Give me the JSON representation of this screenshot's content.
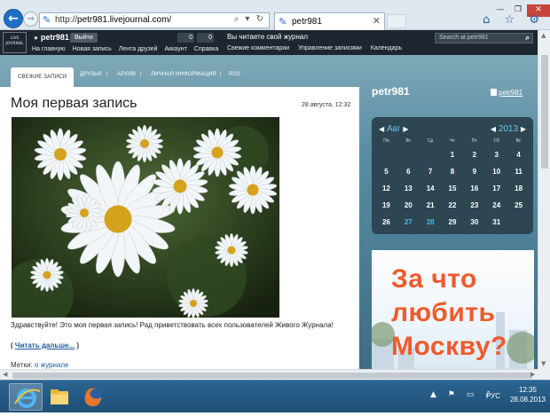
{
  "browser": {
    "url_prefix": "http://",
    "url_host": "petr981.livejournal.com/",
    "tab_title": "petr981",
    "address_tools": "⌕ ▾ ↻",
    "tab_close": "✕",
    "window_buttons": {
      "minimize": "—",
      "maximize": "❐",
      "close": "✕"
    },
    "toolbar_icons": "⌂ ☆ ⚙"
  },
  "lj_header": {
    "logo_text": "LIVE JOURNAL",
    "username": "petr981",
    "logout_label": "Выйти",
    "counter_1": "0",
    "counter_2": "0",
    "menu": [
      "На главную",
      "Новая запись",
      "Лента друзей",
      "Аккаунт",
      "Справка"
    ],
    "reading_own": "Вы читаете свой журнал",
    "submenu": [
      "Свежие комментарии",
      "Управление записями",
      "Календарь"
    ],
    "search_placeholder": "Search at petr981",
    "search_icon": "🔍"
  },
  "journal_tabs": [
    {
      "label": "СВЕЖИЕ ЗАПИСИ",
      "active": true
    },
    {
      "label": "ДРУЗЬЯ",
      "active": false
    },
    {
      "label": "АРХИВ",
      "active": false
    },
    {
      "label": "ЛИЧНАЯ ИНФОРМАЦИЯ",
      "active": false
    },
    {
      "label": "RSS",
      "active": false
    }
  ],
  "tab_separator": "|",
  "post": {
    "title": "Моя первая запись",
    "date": "28 августа, 12:32",
    "text": "Здравствуйте! Это моя первая запись! Рад приветствовать всех пользователей Живого Журнала!",
    "read_more_open": "( ",
    "read_more": "Читать дальше...",
    "read_more_close": " )",
    "tags_label": "Метки: ",
    "tags": "о журнале"
  },
  "sidebar": {
    "journal_name": "petr981",
    "user_link": "petr981"
  },
  "calendar": {
    "month": "Авг",
    "year": "2013",
    "prev_arrow": "◀",
    "next_arrow": "▶",
    "weekdays": [
      "Пн",
      "Вт",
      "Ср",
      "Чт",
      "Пт",
      "Сб",
      "Вс"
    ],
    "weeks": [
      [
        "",
        "",
        "",
        "1",
        "2",
        "3",
        "4"
      ],
      [
        "5",
        "6",
        "7",
        "8",
        "9",
        "10",
        "11"
      ],
      [
        "12",
        "13",
        "14",
        "15",
        "16",
        "17",
        "18"
      ],
      [
        "19",
        "20",
        "21",
        "22",
        "23",
        "24",
        "25"
      ],
      [
        "26",
        "27",
        "28",
        "29",
        "30",
        "31",
        ""
      ]
    ],
    "highlighted_days": [
      "27",
      "28"
    ],
    "accent_color": "#4ab8ee"
  },
  "ad": {
    "lines": [
      "За что",
      "любить",
      "Москву?"
    ],
    "color": "#ef5a2c"
  },
  "scrollbar_arrows": {
    "up": "▲",
    "down": "▼",
    "left": "◀",
    "right": "▶"
  },
  "taskbar": {
    "apps": [
      "ie-icon",
      "file-explorer-icon",
      "firefox-icon"
    ],
    "tray_icons": "▲ ⚑ ▭ ♪",
    "language": "РУС",
    "time": "12:35",
    "date": "28.08.2013"
  }
}
